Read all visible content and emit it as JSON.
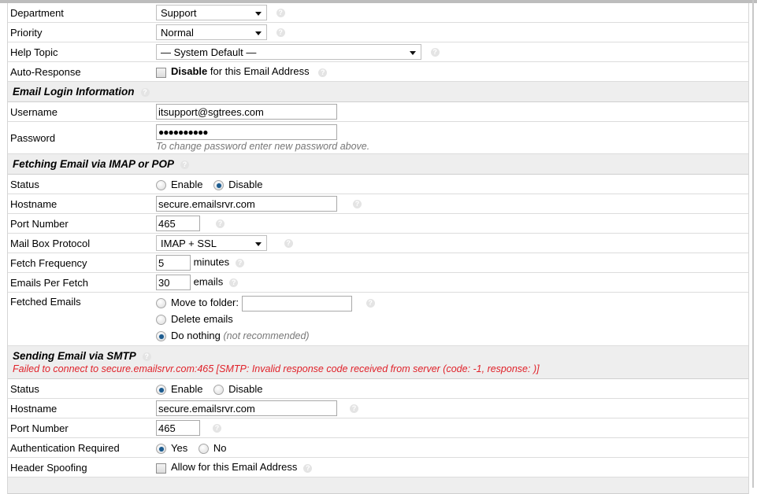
{
  "general": {
    "department": {
      "label": "Department",
      "value": "Support"
    },
    "priority": {
      "label": "Priority",
      "value": "Normal"
    },
    "help_topic": {
      "label": "Help Topic",
      "value": "— System Default —"
    },
    "auto_response": {
      "label": "Auto-Response",
      "checked": false,
      "bold": "Disable",
      "text": " for this Email Address"
    }
  },
  "login": {
    "header": "Email Login Information",
    "username": {
      "label": "Username",
      "value": "itsupport@sgtrees.com"
    },
    "password": {
      "label": "Password",
      "value": "●●●●●●●●●●",
      "hint": "To change password enter new password above."
    }
  },
  "fetching": {
    "header": "Fetching Email via IMAP or POP",
    "status": {
      "label": "Status",
      "options": [
        "Enable",
        "Disable"
      ],
      "selected": "Disable"
    },
    "hostname": {
      "label": "Hostname",
      "value": "secure.emailsrvr.com"
    },
    "port": {
      "label": "Port Number",
      "value": "465"
    },
    "protocol": {
      "label": "Mail Box Protocol",
      "value": "IMAP + SSL"
    },
    "frequency": {
      "label": "Fetch Frequency",
      "value": "5",
      "unit": "minutes"
    },
    "per_fetch": {
      "label": "Emails Per Fetch",
      "value": "30",
      "unit": "emails"
    },
    "fetched": {
      "label": "Fetched Emails",
      "move_label": "Move to folder:",
      "move_value": "",
      "delete_label": "Delete emails",
      "nothing_label": "Do nothing",
      "nothing_hint": "(not recommended)",
      "selected": "Do nothing"
    }
  },
  "smtp": {
    "header": "Sending Email via SMTP",
    "error": "Failed to connect to secure.emailsrvr.com:465 [SMTP: Invalid response code received from server (code: -1, response: )]",
    "status": {
      "label": "Status",
      "options": [
        "Enable",
        "Disable"
      ],
      "selected": "Enable"
    },
    "hostname": {
      "label": "Hostname",
      "value": "secure.emailsrvr.com"
    },
    "port": {
      "label": "Port Number",
      "value": "465"
    },
    "auth": {
      "label": "Authentication Required",
      "options": [
        "Yes",
        "No"
      ],
      "selected": "Yes"
    },
    "spoofing": {
      "label": "Header Spoofing",
      "checked": false,
      "text": "Allow for this Email Address"
    }
  },
  "icons": {
    "help": "?"
  },
  "colors": {
    "error": "#e0222a",
    "header_bg": "#eeeeee",
    "radio_on": "#1d5b8e"
  }
}
